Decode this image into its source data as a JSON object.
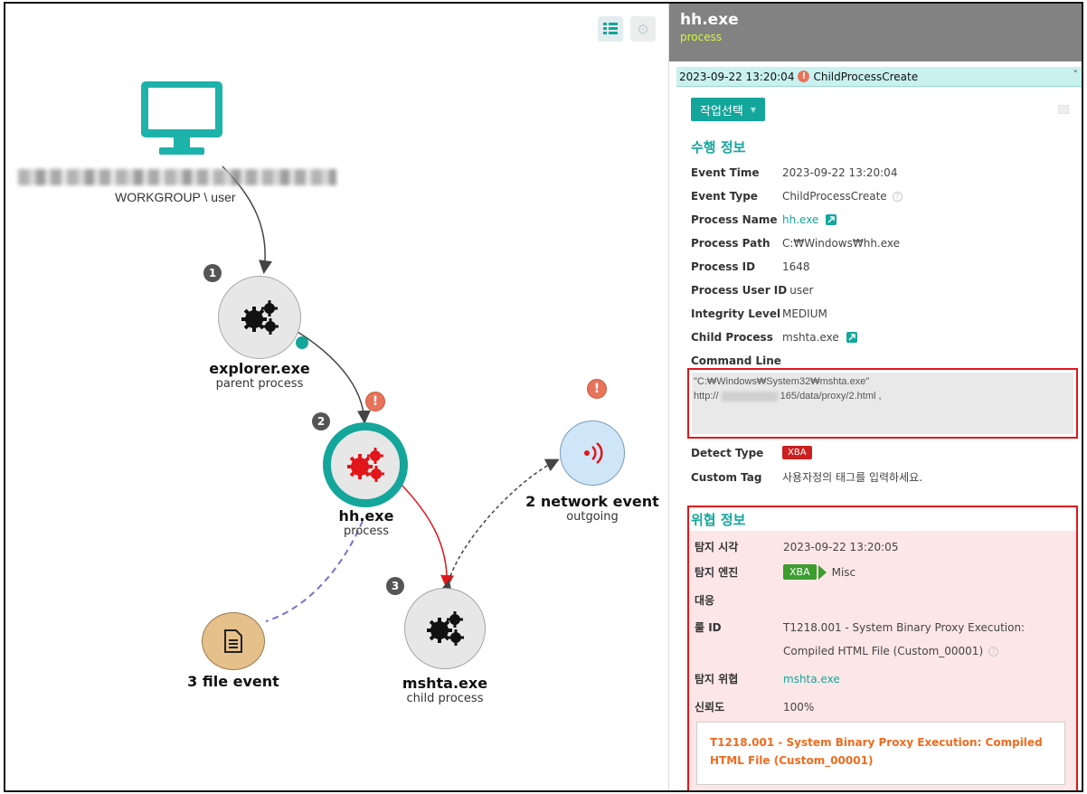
{
  "graph": {
    "host_label": "WORKGROUP \\ user",
    "nodes": [
      {
        "index": "1",
        "title": "explorer.exe",
        "subtitle": "parent process"
      },
      {
        "index": "2",
        "title": "hh.exe",
        "subtitle": "process"
      },
      {
        "index": "3",
        "title": "mshta.exe",
        "subtitle": "child process"
      }
    ],
    "network": {
      "title": "2 network event",
      "subtitle": "outgoing"
    },
    "file": {
      "title": "3 file event"
    },
    "alert_symbol": "!"
  },
  "panel": {
    "title": "hh.exe",
    "subtitle": "process",
    "event_select": {
      "time": "2023-09-22 13:20:04",
      "type": "ChildProcessCreate"
    },
    "action_button": "작업선택",
    "exec_section": "수행 정보",
    "fields": [
      {
        "key": "Event Time",
        "value": "2023-09-22 13:20:04"
      },
      {
        "key": "Event Type",
        "value": "ChildProcessCreate"
      },
      {
        "key": "Process Name",
        "value": "hh.exe"
      },
      {
        "key": "Process Path",
        "value": "C:₩Windows₩hh.exe"
      },
      {
        "key": "Process ID",
        "value": "1648"
      },
      {
        "key": "Process User ID",
        "value": "user"
      },
      {
        "key": "Integrity Level",
        "value": "MEDIUM"
      },
      {
        "key": "Child Process",
        "value": "mshta.exe"
      }
    ],
    "command_line_label": "Command Line",
    "command_line_1": "\"C:₩Windows₩System32₩mshta.exe\"",
    "command_line_2a": "http://",
    "command_line_2b": "165/data/proxy/2.html ,",
    "detect_type_label": "Detect Type",
    "detect_type_value": "XBA",
    "custom_tag_label": "Custom Tag",
    "custom_tag_placeholder": "사용자정의 태그를 입력하세요.",
    "threat": {
      "section": "위협 정보",
      "detect_time_label": "탐지 시각",
      "detect_time": "2023-09-22 13:20:05",
      "engine_label": "탐지 엔진",
      "engine_tag": "XBA",
      "engine_value": "Misc",
      "response_label": "대응",
      "rule_label": "룰 ID",
      "rule_line1": "T1218.001 - System Binary Proxy Execution:",
      "rule_line2": "Compiled HTML File (Custom_00001)",
      "threat_label": "탐지 위협",
      "threat_value": "mshta.exe",
      "confidence_label": "신뢰도",
      "confidence_value": "100%",
      "rule_box": "T1218.001 - System Binary Proxy Execution: Compiled HTML File (Custom_00001)"
    }
  },
  "colors": {
    "accent": "#14a69b",
    "alert": "#e8735a",
    "red": "#e0161b",
    "threat_bg": "#fde6e7"
  }
}
